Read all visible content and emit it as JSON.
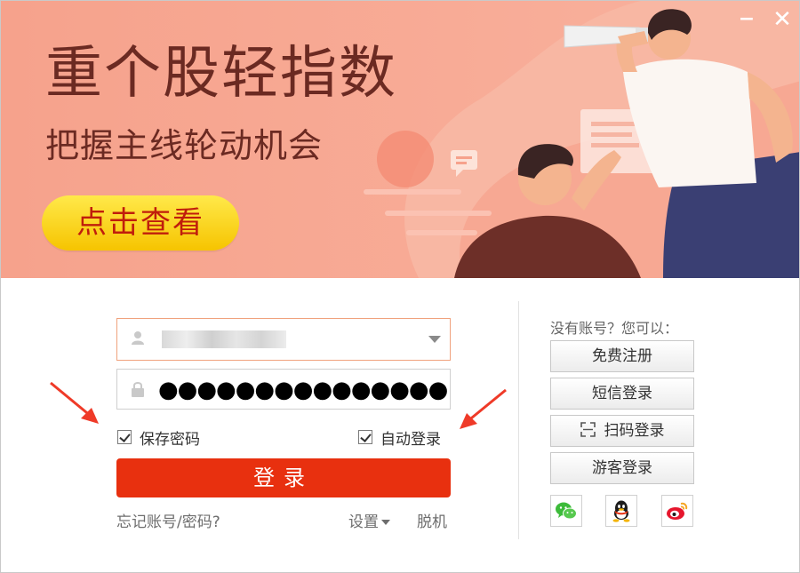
{
  "banner": {
    "headline": "重个股轻指数",
    "subline": "把握主线轮动机会",
    "cta_label": "点击查看",
    "bg_color": "#f7a48e",
    "text_color": "#6b2a22"
  },
  "window_controls": {
    "minimize_glyph": "−",
    "close_glyph": "✕"
  },
  "login": {
    "username_icon": "user-icon",
    "password_icon": "lock-icon",
    "password_mask": "●●●●●●●●●●●●●●●●●●●●",
    "save_password_label": "保存密码",
    "save_password_checked": true,
    "auto_login_label": "自动登录",
    "auto_login_checked": true,
    "login_button_label": "登录",
    "accent_color": "#e8300f"
  },
  "links": {
    "forgot": "忘记账号/密码?",
    "settings": "设置",
    "offline": "脱机"
  },
  "side": {
    "no_account": "没有账号？您可以：",
    "register": "免费注册",
    "sms_login": "短信登录",
    "qr_login": "扫码登录",
    "guest_login": "游客登录",
    "social": [
      "wechat-icon",
      "qq-icon",
      "weibo-icon"
    ]
  }
}
